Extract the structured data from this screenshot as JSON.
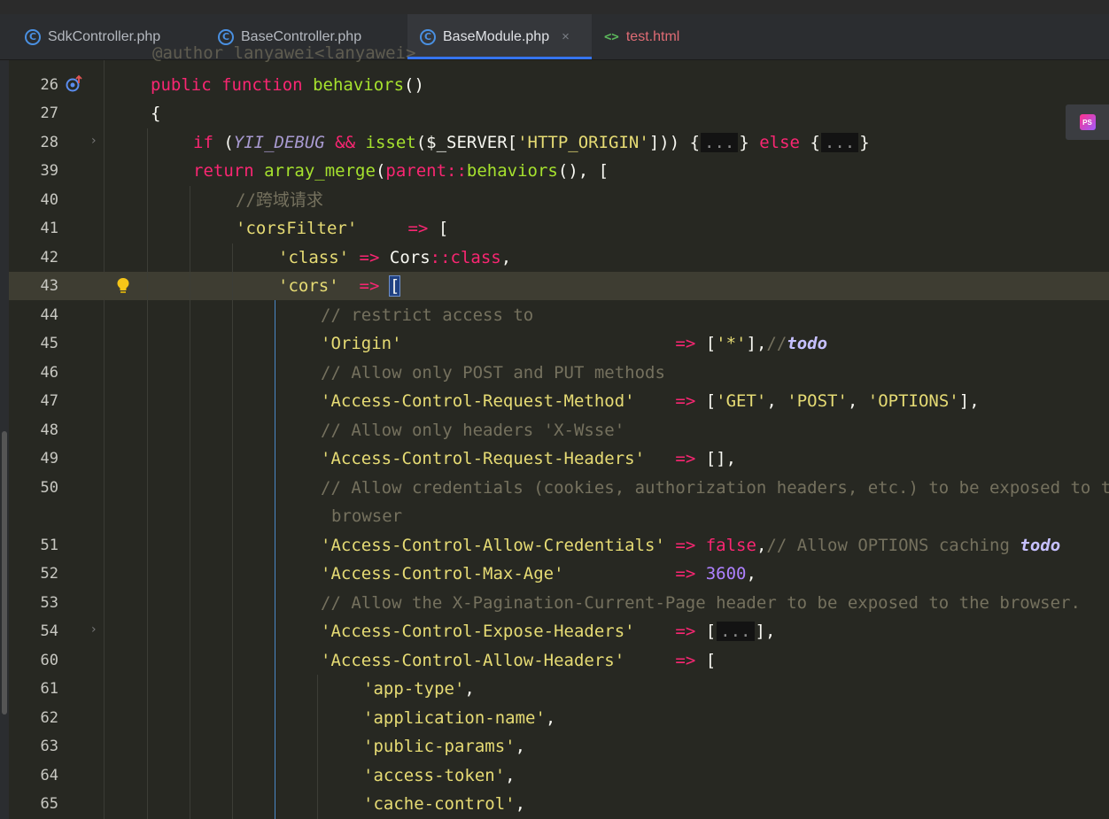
{
  "tabs": [
    {
      "label": "SdkController.php",
      "icon": "php-class-icon"
    },
    {
      "label": "BaseController.php",
      "icon": "php-class-icon"
    },
    {
      "label": "BaseModule.php",
      "icon": "php-class-icon",
      "active": true,
      "close": "×"
    },
    {
      "label": "test.html",
      "icon": "html-file-icon",
      "icon_glyph": "<>"
    }
  ],
  "colors": {
    "background": "#272822",
    "keyword": "#f92672",
    "function": "#a6e22e",
    "string": "#e6db74",
    "comment": "#75715e",
    "number": "#ae81ff",
    "accent": "#3574f0"
  },
  "line_numbers": [
    "26",
    "27",
    "28",
    "39",
    "40",
    "41",
    "42",
    "43",
    "44",
    "45",
    "46",
    "47",
    "48",
    "49",
    "50",
    "",
    "51",
    "52",
    "53",
    "54",
    "60",
    "61",
    "62",
    "63",
    "64",
    "65"
  ],
  "code": {
    "partial_top": "@author lanyawei<lanyawei>",
    "l26": {
      "kw1": "public",
      "kw2": "function",
      "name": "behaviors",
      "rest": "()"
    },
    "l27": "{",
    "l28": {
      "kw": "if",
      "open": " (",
      "const": "YII_DEBUG",
      "and": " && ",
      "fn": "isset",
      "var": "($_SERVER[",
      "str": "'HTTP_ORIGIN'",
      "close": "])) {",
      "fold1": "...",
      "mid": "} ",
      "kw2": "else",
      "open2": " {",
      "fold2": "...",
      "end": "}"
    },
    "l39": {
      "kw": "return",
      "fn": "array_merge",
      "p1": "(",
      "parent": "parent",
      "dc": "::",
      "fn2": "behaviors",
      "rest": "(), ["
    },
    "l40": "//跨域请求",
    "l41": {
      "str": "'corsFilter'",
      "arrow": "=>",
      "rest": "["
    },
    "l42": {
      "str": "'class'",
      "arrow": "=>",
      "cls": "Cors",
      "dc": "::",
      "kw": "class",
      "end": ","
    },
    "l43": {
      "str": "'cors'",
      "arrow": "=>",
      "bracket": "["
    },
    "l44": "// restrict access to",
    "l45": {
      "str": "'Origin'",
      "arrow": "=>",
      "p": "[",
      "val": "'*'",
      "p2": "],",
      "cm": "//",
      "todo": "todo"
    },
    "l46": "// Allow only POST and PUT methods",
    "l47": {
      "str": "'Access-Control-Request-Method'",
      "arrow": "=>",
      "p": "[",
      "v1": "'GET'",
      "sep": ", ",
      "v2": "'POST'",
      "v3": "'OPTIONS'",
      "end": "],"
    },
    "l48": "// Allow only headers 'X-Wsse'",
    "l49": {
      "str": "'Access-Control-Request-Headers'",
      "arrow": "=>",
      "rest": "[],"
    },
    "l50a": "// Allow credentials (cookies, authorization headers, etc.) to be exposed to the",
    "l50b": "browser",
    "l51": {
      "str": "'Access-Control-Allow-Credentials'",
      "arrow": "=>",
      "kw": "false",
      "comma": ",",
      "cm": "// Allow OPTIONS caching ",
      "todo": "todo"
    },
    "l52": {
      "str": "'Access-Control-Max-Age'",
      "arrow": "=>",
      "num": "3600",
      "end": ","
    },
    "l53": "// Allow the X-Pagination-Current-Page header to be exposed to the browser.",
    "l54": {
      "str": "'Access-Control-Expose-Headers'",
      "arrow": "=>",
      "p": "[",
      "fold": "...",
      "end": "],"
    },
    "l60": {
      "str": "'Access-Control-Allow-Headers'",
      "arrow": "=>",
      "rest": "["
    },
    "l61": {
      "str": "'app-type'",
      "end": ","
    },
    "l62": {
      "str": "'application-name'",
      "end": ","
    },
    "l63": {
      "str": "'public-params'",
      "end": ","
    },
    "l64": {
      "str": "'access-token'",
      "end": ","
    },
    "l65": {
      "str": "'cache-control'",
      "end": ","
    }
  },
  "badge": {
    "logo_text": "PS"
  }
}
